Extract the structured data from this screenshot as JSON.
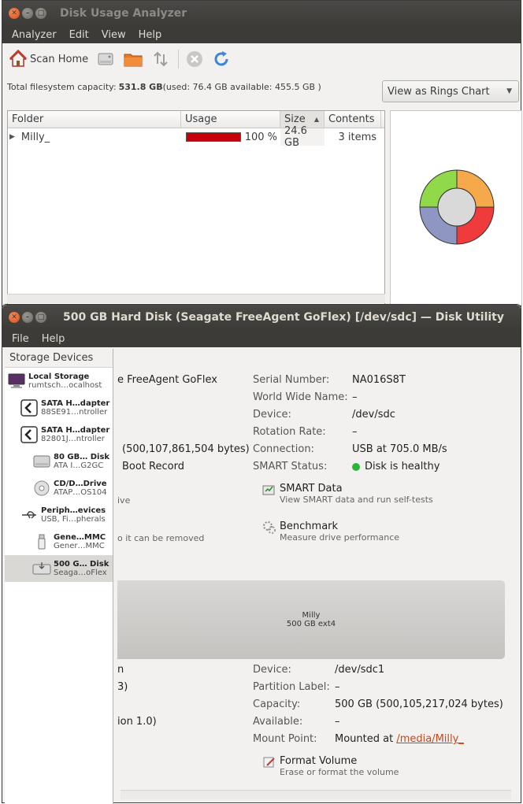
{
  "analyzer": {
    "title": "Disk Usage Analyzer",
    "menu": [
      "Analyzer",
      "Edit",
      "View",
      "Help"
    ],
    "toolbar": {
      "scan_home": "Scan Home"
    },
    "capacity": {
      "prefix": "Total filesystem capacity: ",
      "total": "531.8 GB",
      "suffix": " (used: 76.4 GB available: 455.5 GB )"
    },
    "view_combo": "View as Rings Chart",
    "columns": [
      "Folder",
      "Usage",
      "Size",
      "Contents"
    ],
    "rows": [
      {
        "folder": "Milly_",
        "usage_pct": 100,
        "usage_label": "100 %",
        "size": "24.6 GB",
        "contents": "3 items"
      }
    ],
    "ring_colors": [
      "#f5a94b",
      "#ef3b3b",
      "#8f96c2",
      "#8fd94a"
    ]
  },
  "disk_utility": {
    "title": "500 GB Hard Disk (Seagate FreeAgent GoFlex) [/dev/sdc] — Disk Utility",
    "menu": [
      "File",
      "Help"
    ],
    "sidebar_title": "Storage Devices",
    "devices": [
      {
        "t1": "Local Storage",
        "t2": "rumtsch…ocalhost",
        "icon": "computer-icon"
      },
      {
        "t1": "SATA H…dapter",
        "t2": "88SE91…ntroller",
        "icon": "sata-controller-icon"
      },
      {
        "t1": "SATA H…dapter",
        "t2": "82801J…ntroller",
        "icon": "sata-controller-icon"
      },
      {
        "t1": "80 GB… Disk",
        "t2": "ATA I…G2GC",
        "icon": "hard-disk-icon"
      },
      {
        "t1": "CD/D…Drive",
        "t2": "ATAP…OS104",
        "icon": "optical-drive-icon"
      },
      {
        "t1": "Periph…evices",
        "t2": "USB, Fi…pherals",
        "icon": "usb-icon"
      },
      {
        "t1": "Gene…MMC",
        "t2": "Gener…MMC",
        "icon": "usb-stick-icon"
      },
      {
        "t1": "500 G… Disk",
        "t2": "Seaga…oFlex",
        "icon": "external-disk-icon"
      }
    ],
    "drive": {
      "model_partial": "e FreeAgent GoFlex",
      "capacity_partial": "(500,107,861,504 bytes)",
      "partitioning_partial": "Boot Record",
      "ive_partial": "ive",
      "removed_partial": "o it can be removed",
      "serial_label": "Serial Number:",
      "serial": "NA016S8T",
      "wwn_label": "World Wide Name:",
      "wwn": "–",
      "device_label": "Device:",
      "device": "/dev/sdc",
      "rotation_label": "Rotation Rate:",
      "rotation": "–",
      "connection_label": "Connection:",
      "connection": "USB at 705.0 MB/s",
      "smart_label": "SMART Status:",
      "smart": "Disk is healthy",
      "smart_action": "SMART Data",
      "smart_action_desc": "View SMART data and run self-tests",
      "bench_action": "Benchmark",
      "bench_action_desc": "Measure drive performance"
    },
    "partition_map": {
      "name": "Milly",
      "desc": "500 GB ext4"
    },
    "volume": {
      "partial1": "n",
      "partial2": "3)",
      "partial3": "ion 1.0)",
      "device_label": "Device:",
      "device": "/dev/sdc1",
      "plabel_label": "Partition Label:",
      "plabel": "–",
      "capacity_label": "Capacity:",
      "capacity": "500 GB (500,105,217,024 bytes)",
      "available_label": "Available:",
      "available": "–",
      "mount_label": "Mount Point:",
      "mount_prefix": "Mounted at ",
      "mount_link": "/media/Milly_",
      "format_action": "Format Volume",
      "format_action_desc": "Erase or format the volume"
    }
  }
}
